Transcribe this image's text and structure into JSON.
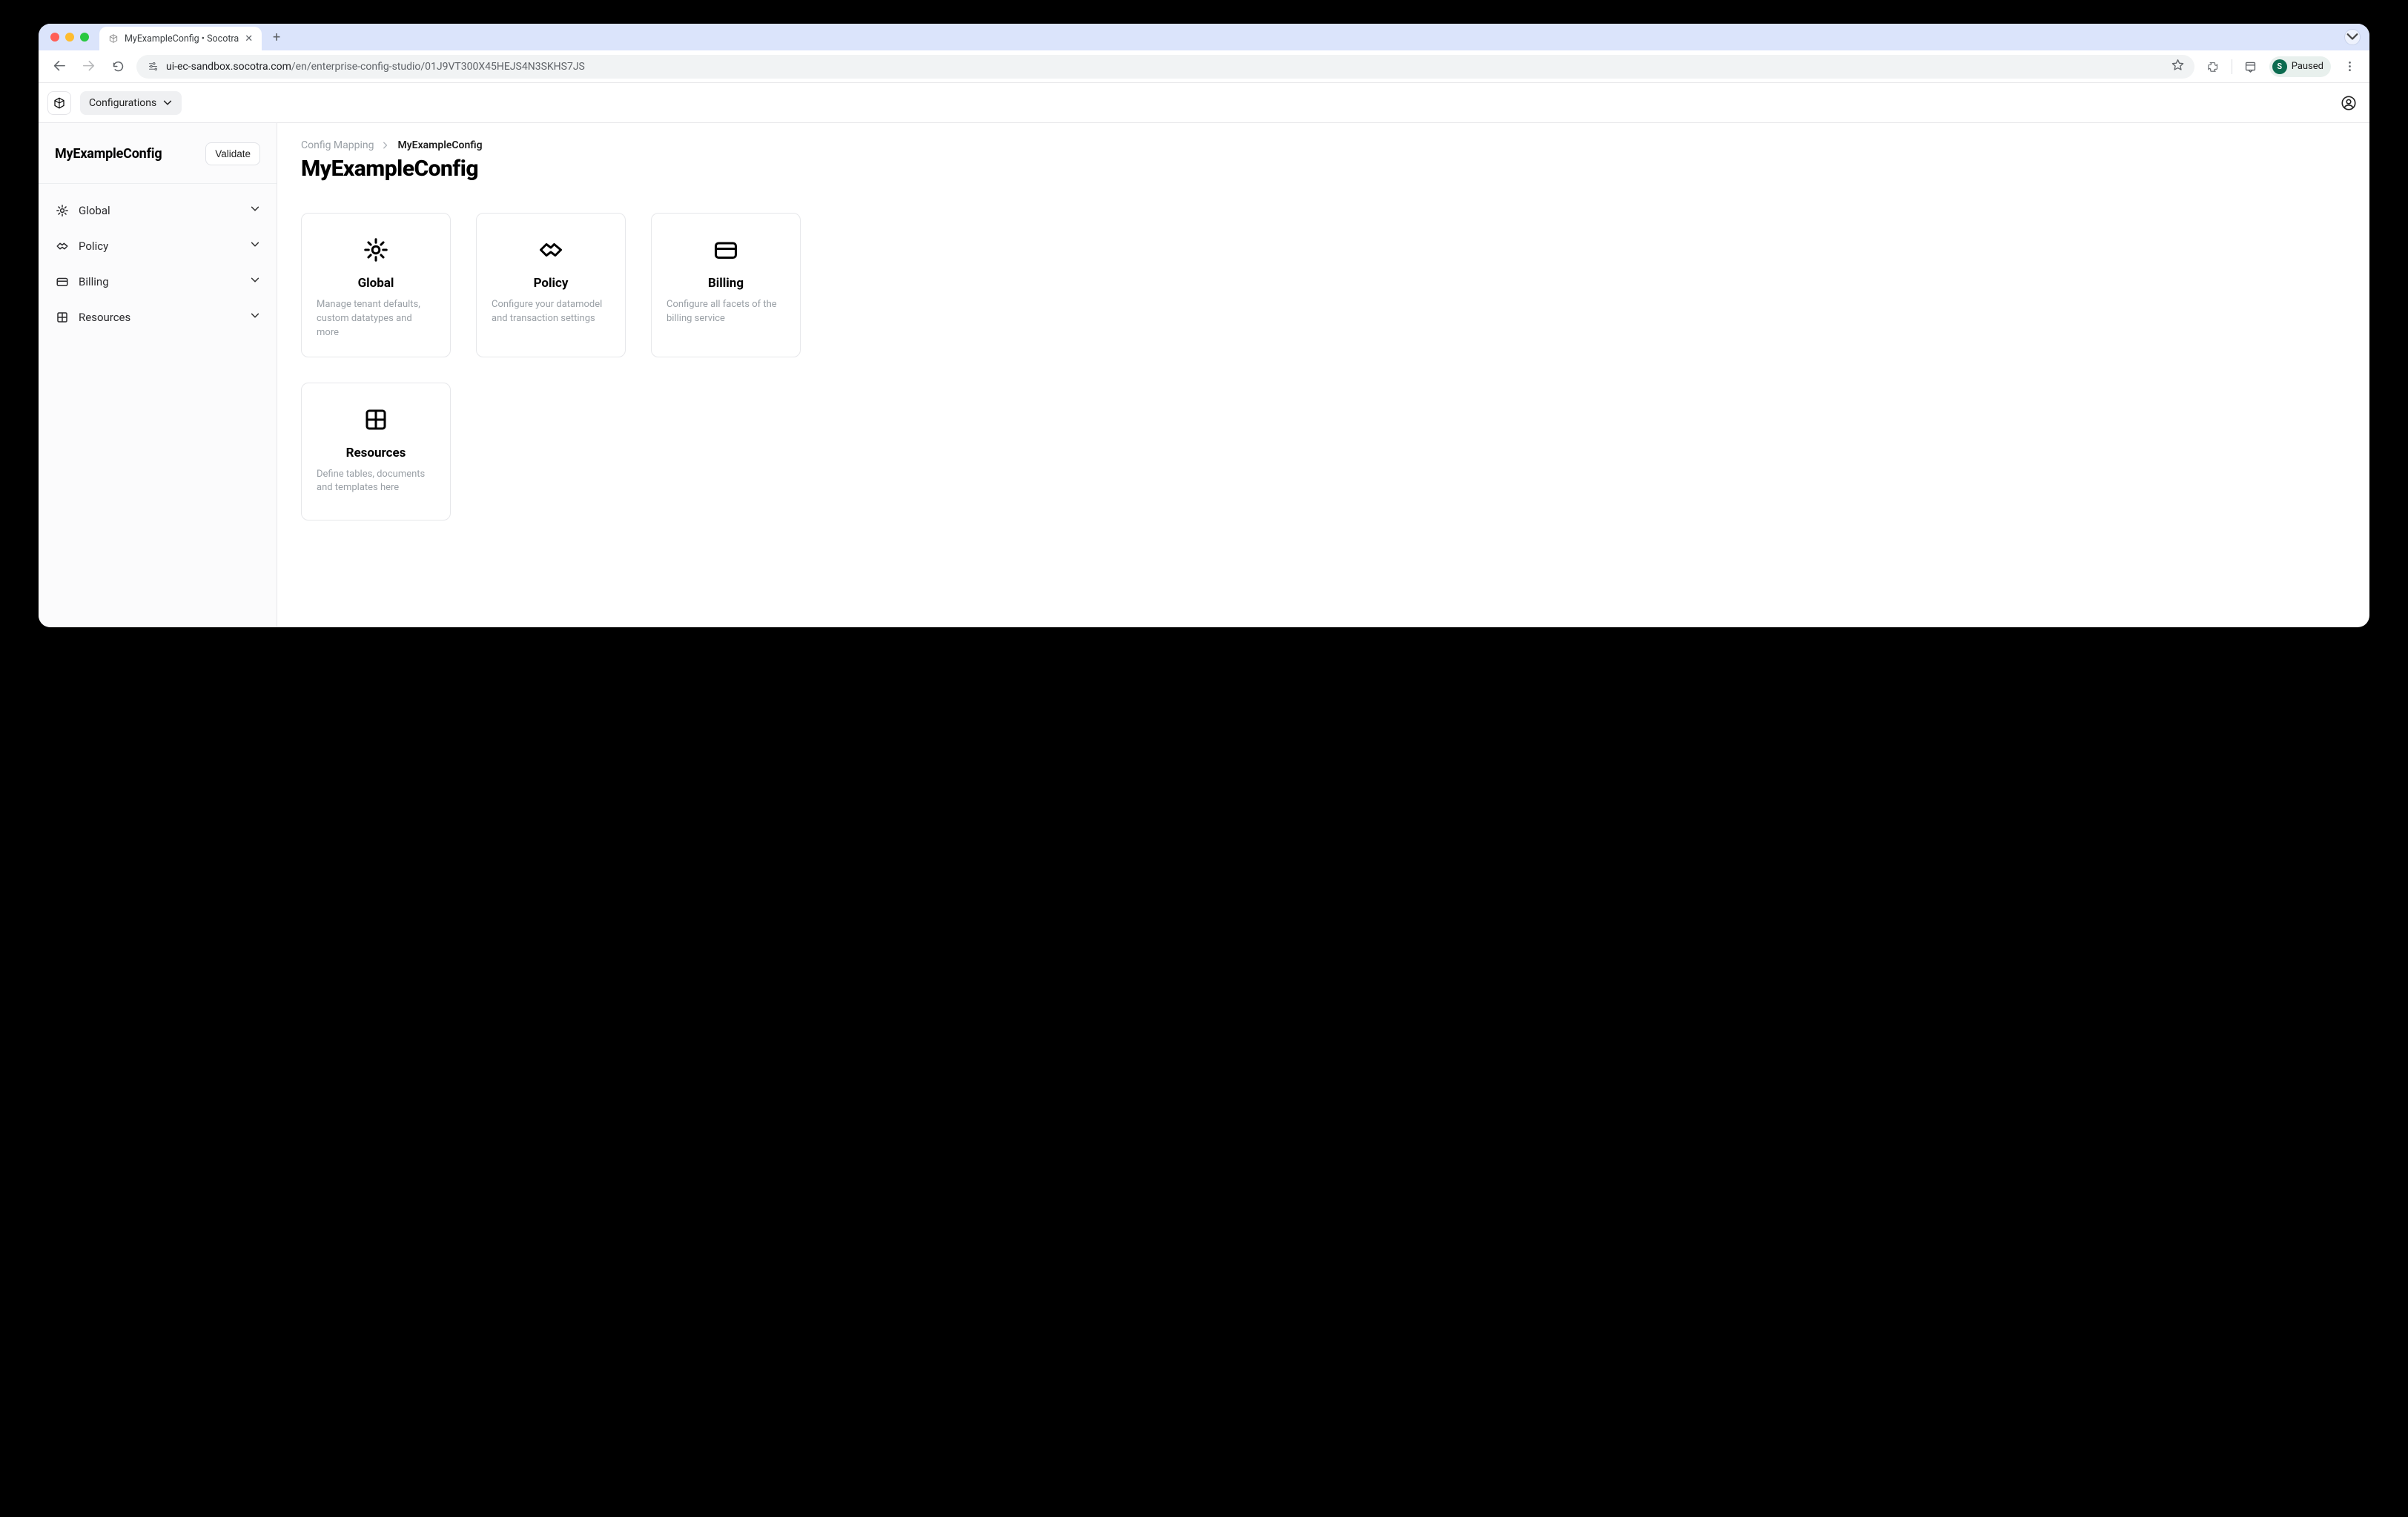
{
  "browser": {
    "tab_title": "MyExampleConfig • Socotra",
    "url_host": "ui-ec-sandbox.socotra.com",
    "url_path": "/en/enterprise-config-studio/01J9VT300X45HEJS4N3SKHS7JS",
    "profile_initial": "S",
    "profile_status": "Paused"
  },
  "appbar": {
    "configurations_label": "Configurations"
  },
  "sidebar": {
    "title": "MyExampleConfig",
    "validate_label": "Validate",
    "items": [
      {
        "label": "Global",
        "icon": "gear"
      },
      {
        "label": "Policy",
        "icon": "handshake"
      },
      {
        "label": "Billing",
        "icon": "card"
      },
      {
        "label": "Resources",
        "icon": "grid"
      }
    ]
  },
  "breadcrumbs": {
    "root": "Config Mapping",
    "current": "MyExampleConfig"
  },
  "page": {
    "title": "MyExampleConfig"
  },
  "cards": [
    {
      "title": "Global",
      "desc": "Manage tenant defaults, custom datatypes and more",
      "icon": "gear"
    },
    {
      "title": "Policy",
      "desc": "Configure your datamodel and transaction settings",
      "icon": "handshake"
    },
    {
      "title": "Billing",
      "desc": "Configure all facets of the billing service",
      "icon": "card"
    },
    {
      "title": "Resources",
      "desc": "Define tables, documents and templates here",
      "icon": "grid"
    }
  ]
}
